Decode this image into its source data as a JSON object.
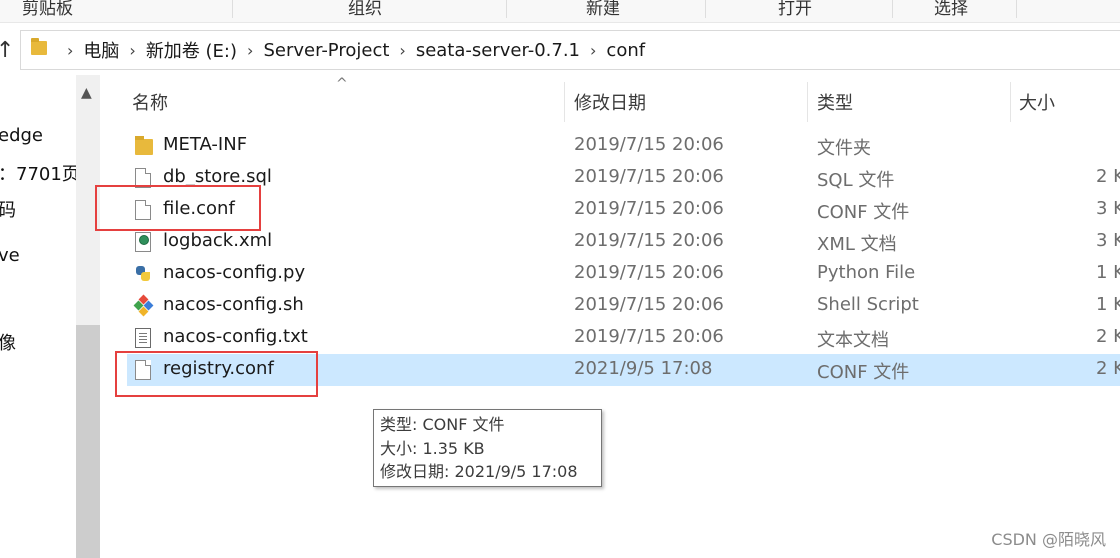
{
  "ribbon": {
    "groups": [
      "剪贴板",
      "组织",
      "新建",
      "打开",
      "选择"
    ]
  },
  "address": {
    "up_icon": "up-arrow-icon",
    "crumbs": [
      "电脑",
      "新加卷 (E:)",
      "Server-Project",
      "seata-server-0.7.1",
      "conf"
    ]
  },
  "nav": {
    "items": [
      "edge",
      "：7701页",
      "码",
      "ve",
      "像"
    ]
  },
  "columns": {
    "name": "名称",
    "date": "修改日期",
    "type": "类型",
    "size": "大小"
  },
  "files": [
    {
      "name": "META-INF",
      "date": "2019/7/15 20:06",
      "type": "文件夹",
      "size": "",
      "icon": "folder-icon"
    },
    {
      "name": "db_store.sql",
      "date": "2019/7/15 20:06",
      "type": "SQL 文件",
      "size": "2 K",
      "icon": "file-icon"
    },
    {
      "name": "file.conf",
      "date": "2019/7/15 20:06",
      "type": "CONF 文件",
      "size": "3 K",
      "icon": "file-icon"
    },
    {
      "name": "logback.xml",
      "date": "2019/7/15 20:06",
      "type": "XML 文档",
      "size": "3 K",
      "icon": "xml-file-icon"
    },
    {
      "name": "nacos-config.py",
      "date": "2019/7/15 20:06",
      "type": "Python File",
      "size": "1 K",
      "icon": "python-file-icon"
    },
    {
      "name": "nacos-config.sh",
      "date": "2019/7/15 20:06",
      "type": "Shell Script",
      "size": "1 K",
      "icon": "shell-script-icon"
    },
    {
      "name": "nacos-config.txt",
      "date": "2019/7/15 20:06",
      "type": "文本文档",
      "size": "2 K",
      "icon": "text-file-icon"
    },
    {
      "name": "registry.conf",
      "date": "2021/9/5 17:08",
      "type": "CONF 文件",
      "size": "2 K",
      "icon": "file-icon",
      "selected": true
    }
  ],
  "tooltip": {
    "line1": "类型: CONF 文件",
    "line2": "大小: 1.35 KB",
    "line3": "修改日期: 2021/9/5 17:08"
  },
  "watermark": "CSDN @陌晓风",
  "colors": {
    "selection": "#cce8ff",
    "highlight_box": "#e5403f",
    "folder": "#e8b93c"
  }
}
